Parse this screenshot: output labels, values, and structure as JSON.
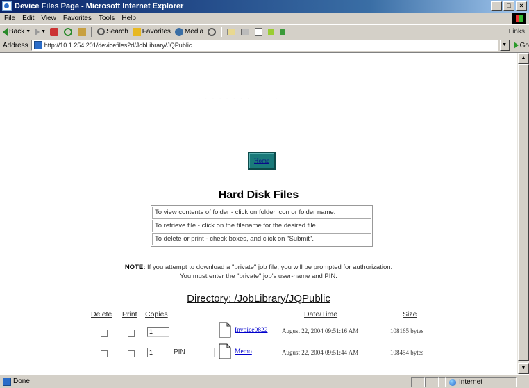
{
  "window": {
    "title": "Device Files Page - Microsoft Internet Explorer"
  },
  "menu": [
    "File",
    "Edit",
    "View",
    "Favorites",
    "Tools",
    "Help"
  ],
  "toolbar": {
    "back": "Back",
    "search": "Search",
    "favorites": "Favorites",
    "media": "Media",
    "links": "Links"
  },
  "address": {
    "label": "Address",
    "url": "http://10.1.254.201/devicefiles2d/JobLibrary/JQPublic",
    "go": "Go"
  },
  "page": {
    "home_button": "Home",
    "title": "Hard Disk Files",
    "instructions": [
      "To view contents of folder - click on folder icon or folder name.",
      "To retrieve file - click on the filename for the desired file.",
      "To delete or print - check boxes, and click on \"Submit\"."
    ],
    "note_label": "NOTE:",
    "note_line1": "If you attempt to download a \"private\" job file, you will be prompted for authorization.",
    "note_line2": "You must enter the \"private\" job's user-name and PIN.",
    "directory": "Directory: /JobLibrary/JQPublic"
  },
  "table": {
    "headers": {
      "delete": "Delete",
      "print": "Print",
      "copies": "Copies",
      "datetime": "Date/Time",
      "size": "Size"
    },
    "pin_label": "PIN",
    "rows": [
      {
        "copies": "1",
        "name": "Invoice0822",
        "datetime": "August 22, 2004 09:51:16 AM",
        "size": "108165 bytes",
        "has_pin": false
      },
      {
        "copies": "1",
        "name": "Memo",
        "datetime": "August 22, 2004 09:51:44 AM",
        "size": "108454 bytes",
        "has_pin": true
      }
    ]
  },
  "status": {
    "text": "Done",
    "zone": "Internet"
  }
}
